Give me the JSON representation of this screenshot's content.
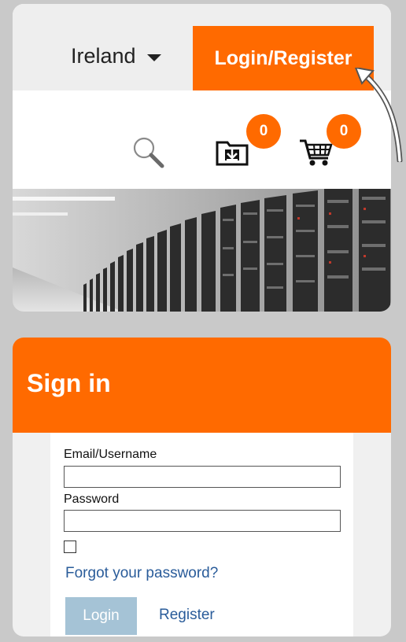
{
  "header": {
    "country": "Ireland",
    "login_register": "Login/Register"
  },
  "icons": {
    "downloads_count": "0",
    "cart_count": "0"
  },
  "signin": {
    "title": "Sign in",
    "email_label": "Email/Username",
    "email_value": "",
    "password_label": "Password",
    "password_value": "",
    "forgot_password": "Forgot your password?",
    "login_button": "Login",
    "register_link": "Register"
  },
  "colors": {
    "accent": "#ff6a00",
    "link": "#2a5c9a",
    "disabled_button": "#a5c3d6"
  }
}
